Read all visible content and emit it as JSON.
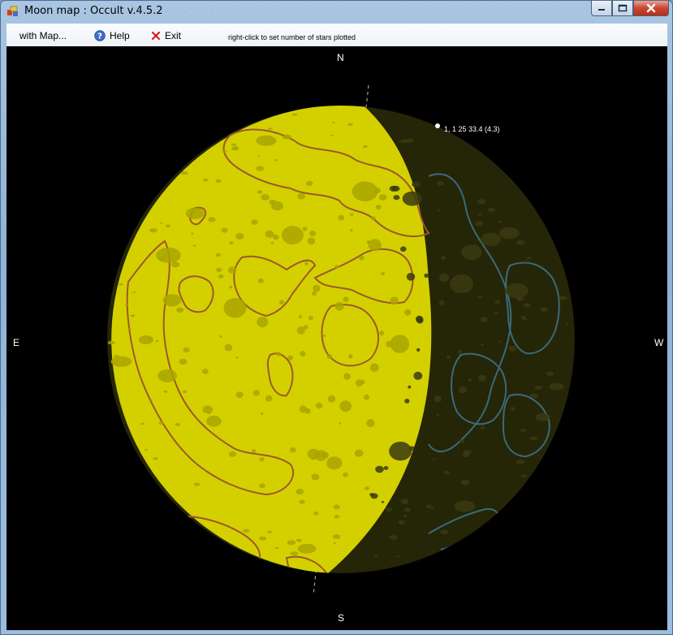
{
  "window": {
    "title": "Moon map : Occult v.4.5.2",
    "icon": "occult-app-icon"
  },
  "menu": {
    "with_map": "with Map...",
    "help": "Help",
    "exit": "Exit",
    "help_icon": "help-circle-icon",
    "exit_icon": "red-x-icon"
  },
  "hint_text": "right-click to set number of stars plotted",
  "compass": {
    "north": "N",
    "south": "S",
    "east": "E",
    "west": "W"
  },
  "star": {
    "label": "1,  1 25 33.4 (4.3)"
  },
  "colors": {
    "sunlit": "#d4d000",
    "dark_limb": "#252508",
    "maria_outline_lit": "#9a5a2a",
    "maria_outline_dark": "#3a6a7a",
    "background": "#000000"
  }
}
